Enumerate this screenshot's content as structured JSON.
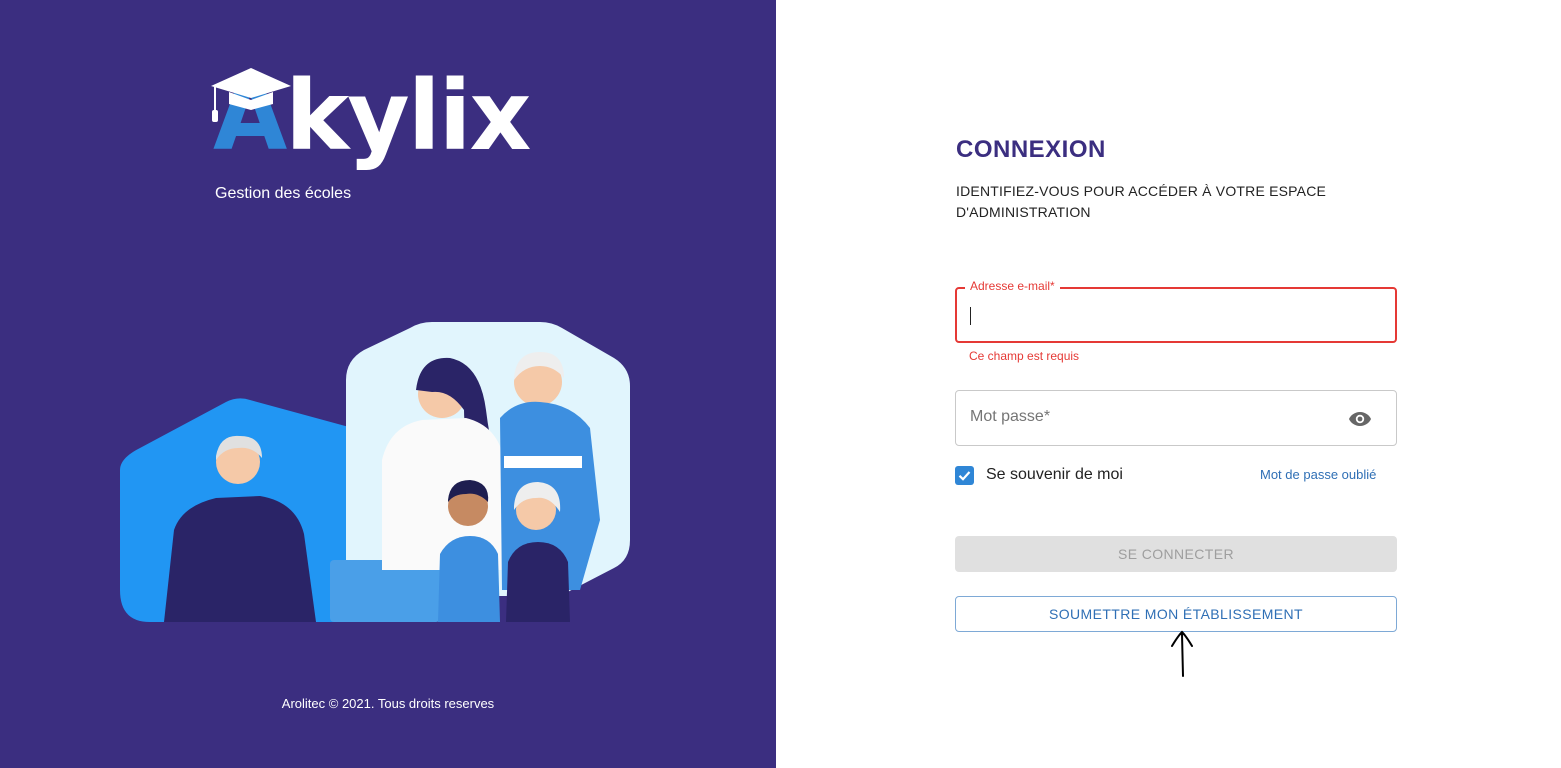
{
  "brand": {
    "logo_first_letter": "A",
    "logo_rest": "kylix",
    "logo_subtitle": "Gestion des écoles",
    "panel_color": "#3b2e80",
    "accent_color": "#2f86d6"
  },
  "footer": {
    "copyright": "Arolitec © 2021. Tous droits reserves"
  },
  "login": {
    "title": "CONNEXION",
    "subtitle": "IDENTIFIEZ-VOUS POUR ACCÉDER À VOTRE ESPACE D'ADMINISTRATION",
    "email": {
      "label": "Adresse e-mail*",
      "value": "",
      "error": "Ce champ est requis",
      "error_color": "#e53935"
    },
    "password": {
      "placeholder": "Mot passe*",
      "icon": "eye-icon"
    },
    "remember_me": {
      "label": "Se souvenir de moi",
      "checked": true
    },
    "forgot_password": "Mot de passe oublié",
    "connect_button": "SE CONNECTER",
    "submit_button": "SOUMETTRE MON ÉTABLISSEMENT"
  }
}
